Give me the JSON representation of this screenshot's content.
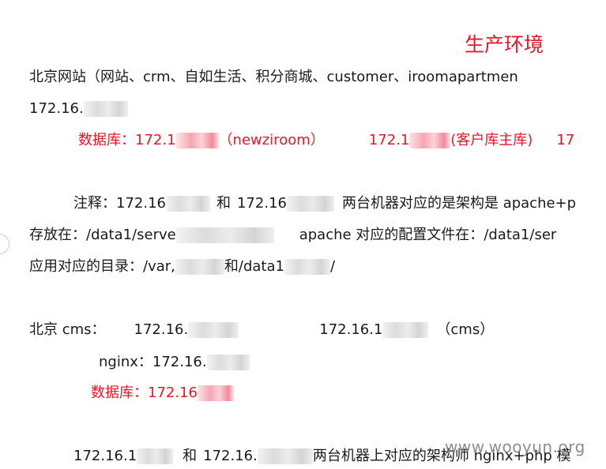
{
  "document": {
    "title": "生产环境",
    "section1": {
      "heading": "北京网站（网站、crm、自如生活、积分商城、customer、iroomapartmen",
      "ip_prefix": "172.16.",
      "db_label": "数据库：",
      "db_ip1_prefix": "172.1",
      "db_ip1_note": "（newziroom）",
      "db_ip2_prefix": "172.1",
      "db_ip2_note": "(客户库主库)",
      "db_ip3_prefix": "17"
    },
    "note": {
      "label": "注释：",
      "ip1_prefix": "172.16",
      "and1": "和",
      "ip2_prefix": "172.16",
      "text": "两台机器对应的是架构是 apache+p",
      "storage_label": "存放在：",
      "storage_path_prefix": "/data1/serve",
      "apache_text": "apache  对应的配置文件在：",
      "config_path": "/data1/ser",
      "app_dir_label": "应用对应的目录：",
      "app_dir_prefix": "/var,",
      "and2": "和",
      "app_dir2_prefix": "/data1",
      "app_dir2_suffix": "/"
    },
    "section2": {
      "label": "北京 cms：",
      "ip1_prefix": "172.16.",
      "ip2_prefix": "172.16.1",
      "ip2_note": "（cms）",
      "nginx_label": "nginx：",
      "nginx_ip_prefix": "172.16.",
      "db_label": "数据库：",
      "db_ip_prefix": "172.16"
    },
    "section3": {
      "ip1_prefix": "172.16.1",
      "and": "和",
      "ip2_prefix": "172.16.",
      "text": "两台机器上对应的架构师 nginx+php 模"
    },
    "watermark": "www.wooyun.org",
    "colors": {
      "red": "#e8182b",
      "text": "#1a1a1a"
    }
  }
}
